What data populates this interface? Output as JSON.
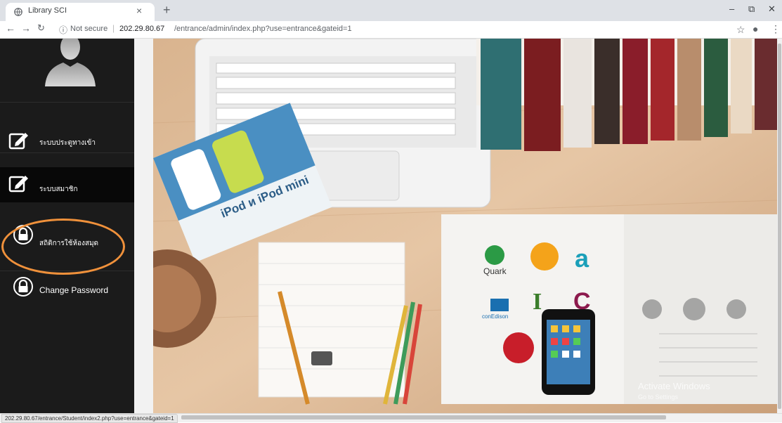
{
  "browser": {
    "tab_title": "Library SCI",
    "close_symbol": "×",
    "new_tab_symbol": "+",
    "security_text": "Not secure",
    "url_host": "202.29.80.67",
    "url_path": "/entrance/admin/index.php?use=entrance&gateid=1",
    "status_url": "202.29.80.67/entrance/Student/index2.php?use=entrance&gateid=1",
    "window_controls": [
      "–",
      "⧉",
      "✕"
    ]
  },
  "sidebar": {
    "items": [
      {
        "label": "ระบบประตูทางเข้า",
        "icon": "edit-icon"
      },
      {
        "label": "ระบบสมาชิก",
        "icon": "edit-icon"
      },
      {
        "label": "สถิติการใช้ห้องสมุด",
        "icon": "lock-icon"
      },
      {
        "label": "Change Password",
        "icon": "lock-icon"
      }
    ],
    "highlight_color": "#f0913b"
  },
  "overlay": {
    "activate_windows": "Activate Windows",
    "go_to_settings": "Go to Settings"
  },
  "hero": {
    "ipod_text": "iPod и iPod mini",
    "logos": [
      "Quark",
      "conEdison"
    ]
  }
}
